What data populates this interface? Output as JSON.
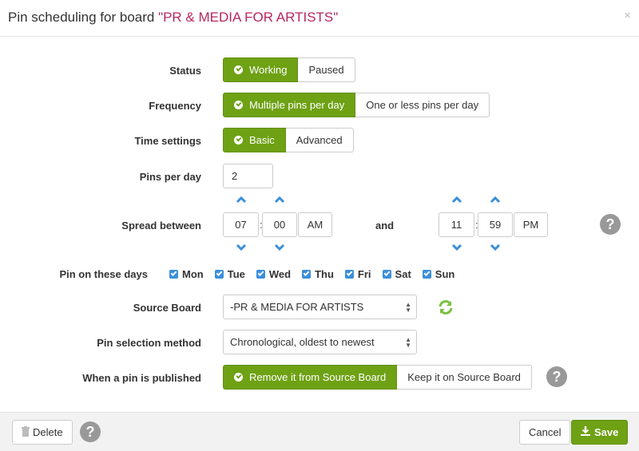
{
  "header": {
    "title_prefix": "Pin scheduling for board ",
    "board_name": "\"PR & MEDIA FOR ARTISTS\"",
    "close_label": "×"
  },
  "colors": {
    "accent": "#6ea114",
    "board_title": "#b8265e",
    "checkbox": "#3b8fd9",
    "arrow": "#3b8fd9",
    "refresh": "#7cc044",
    "help": "#999999"
  },
  "form": {
    "status": {
      "label": "Status",
      "options": [
        "Working",
        "Paused"
      ],
      "selected": "Working"
    },
    "frequency": {
      "label": "Frequency",
      "options": [
        "Multiple pins per day",
        "One or less pins per day"
      ],
      "selected": "Multiple pins per day"
    },
    "time_settings": {
      "label": "Time settings",
      "options": [
        "Basic",
        "Advanced"
      ],
      "selected": "Basic"
    },
    "pins_per_day": {
      "label": "Pins per day",
      "value": "2"
    },
    "spread": {
      "label": "Spread between",
      "start": {
        "hour": "07",
        "minute": "00",
        "ampm": "AM"
      },
      "and_label": "and",
      "end": {
        "hour": "11",
        "minute": "59",
        "ampm": "PM"
      },
      "separator": ":"
    },
    "days": {
      "label": "Pin on these days",
      "items": [
        {
          "name": "Mon",
          "checked": true
        },
        {
          "name": "Tue",
          "checked": true
        },
        {
          "name": "Wed",
          "checked": true
        },
        {
          "name": "Thu",
          "checked": true
        },
        {
          "name": "Fri",
          "checked": true
        },
        {
          "name": "Sat",
          "checked": true
        },
        {
          "name": "Sun",
          "checked": true
        }
      ]
    },
    "source_board": {
      "label": "Source Board",
      "value": "-PR & MEDIA FOR ARTISTS"
    },
    "selection_method": {
      "label": "Pin selection method",
      "value": "Chronological, oldest to newest"
    },
    "when_published": {
      "label": "When a pin is published",
      "options": [
        "Remove it from Source Board",
        "Keep it on Source Board"
      ],
      "selected": "Remove it from Source Board"
    },
    "help_glyph": "?"
  },
  "footer": {
    "delete_label": "Delete",
    "cancel_label": "Cancel",
    "save_label": "Save",
    "help_glyph": "?"
  }
}
